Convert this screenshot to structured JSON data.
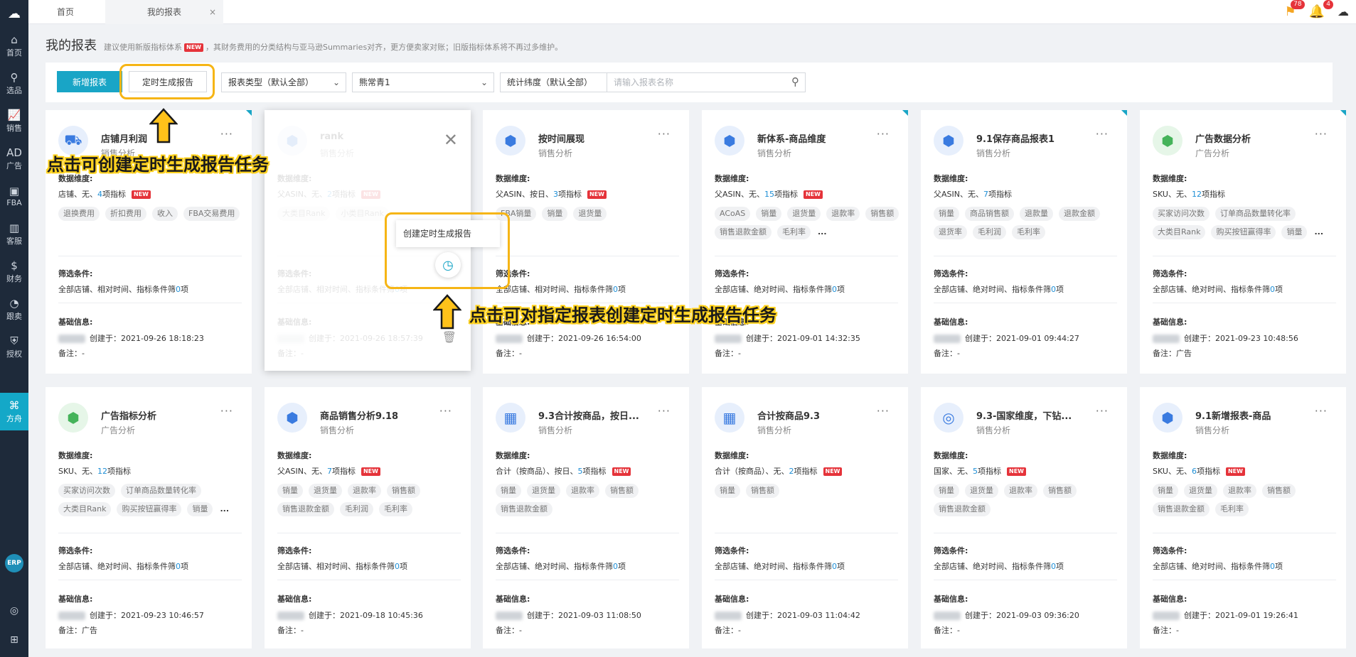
{
  "sidebar": {
    "items": [
      {
        "label": "首页",
        "icon": "home-icon",
        "glyph": "⌂"
      },
      {
        "label": "选品",
        "icon": "search-icon",
        "glyph": "⚲"
      },
      {
        "label": "销售",
        "icon": "chart-icon",
        "glyph": "📈"
      },
      {
        "label": "广告",
        "icon": "ad-icon",
        "glyph": "AD"
      },
      {
        "label": "FBA",
        "icon": "fba-icon",
        "glyph": "▣"
      },
      {
        "label": "客服",
        "icon": "service-icon",
        "glyph": "▥"
      },
      {
        "label": "财务",
        "icon": "finance-icon",
        "glyph": "$"
      },
      {
        "label": "跟卖",
        "icon": "follow-icon",
        "glyph": "◔"
      },
      {
        "label": "授权",
        "icon": "shield-icon",
        "glyph": "⛨"
      },
      {
        "label": "方舟",
        "icon": "ark-icon",
        "glyph": "⌘"
      }
    ],
    "erp": "ERP"
  },
  "tabs": [
    {
      "label": "首页"
    },
    {
      "label": "我的报表",
      "close": "×"
    }
  ],
  "notifications": {
    "flag_count": "78",
    "bell_count": "4"
  },
  "header": {
    "title": "我的报表",
    "note_before": "建议使用新版指标体系",
    "new_tag": "NEW",
    "note_after": "，其财务费用的分类结构与亚马逊Summaries对齐，更方便卖家对账；旧版指标体系将不再过多维护。"
  },
  "toolbar": {
    "new_report": "新增报表",
    "scheduled": "定时生成报告",
    "report_type": "报表类型（默认全部）",
    "store": "熊常青1",
    "stat_dim": "统计纬度（默认全部）",
    "search_placeholder": "请输入报表名称"
  },
  "labels": {
    "dims": "数据维度:",
    "filters": "筛选条件:",
    "basic": "基础信息:",
    "created": "创建于：",
    "remark": "备注："
  },
  "cards": [
    {
      "title": "店铺月利润",
      "sub": "销售分析",
      "dim": "店铺、无、",
      "num": "4",
      "unit": "项指标",
      "new": "NEW",
      "tags": [
        "退换费用",
        "折扣费用",
        "收入",
        "FBA交易费用"
      ],
      "filter_a": "全部店铺、相对时间、指标条件筛",
      "filter_n": "0",
      "filter_b": "项",
      "created": "2021-09-26 18:18:23",
      "remark": "-"
    },
    {
      "title": "rank",
      "sub": "销售分析",
      "dim": "父ASIN、无、",
      "num": "2",
      "unit": "项指标",
      "new": "NEW",
      "tags": [
        "大类目Rank",
        "小类目Rank"
      ],
      "filter_a": "全部店铺、相对时间、指标条件筛",
      "filter_n": "0",
      "filter_b": "项",
      "created": "2021-09-26 18:57:39",
      "remark": "-"
    },
    {
      "title": "按时间展现",
      "sub": "销售分析",
      "dim": "父ASIN、按日、",
      "num": "3",
      "unit": "项指标",
      "new": "NEW",
      "tags": [
        "FBA销量",
        "销量",
        "退货量"
      ],
      "filter_a": "全部店铺、相对时间、指标条件筛",
      "filter_n": "0",
      "filter_b": "项",
      "created": "2021-09-26 16:54:00",
      "remark": "-"
    },
    {
      "title": "新体系-商品维度",
      "sub": "销售分析",
      "dim": "父ASIN、无、",
      "num": "15",
      "unit": "项指标",
      "new": "NEW",
      "tags": [
        "ACoAS",
        "销量",
        "退货量",
        "退款率",
        "销售额",
        "销售退款金额",
        "毛利率",
        "..."
      ],
      "filter_a": "全部店铺、绝对时间、指标条件筛",
      "filter_n": "0",
      "filter_b": "项",
      "created": "2021-09-01 14:32:35",
      "remark": "-"
    },
    {
      "title": "9.1保存商品报表1",
      "sub": "销售分析",
      "dim": "父ASIN、无、",
      "num": "7",
      "unit": "项指标",
      "new": "",
      "tags": [
        "销量",
        "商品销售额",
        "退款量",
        "退款金额",
        "退货率",
        "毛利润",
        "毛利率"
      ],
      "filter_a": "全部店铺、绝对时间、指标条件筛",
      "filter_n": "0",
      "filter_b": "项",
      "created": "2021-09-01 09:44:27",
      "remark": "-"
    },
    {
      "title": "广告数据分析",
      "sub": "广告分析",
      "dim": "SKU、无、",
      "num": "12",
      "unit": "项指标",
      "new": "",
      "tags": [
        "买家访问次数",
        "订单商品数量转化率",
        "大类目Rank",
        "购买按钮赢得率",
        "销量",
        "..."
      ],
      "filter_a": "全部店铺、绝对时间、指标条件筛",
      "filter_n": "0",
      "filter_b": "项",
      "created": "2021-09-23 10:48:56",
      "remark": "广告"
    },
    {
      "title": "广告指标分析",
      "sub": "广告分析",
      "dim": "SKU、无、",
      "num": "12",
      "unit": "项指标",
      "new": "",
      "tags": [
        "买家访问次数",
        "订单商品数量转化率",
        "大类目Rank",
        "购买按钮赢得率",
        "销量",
        "..."
      ],
      "filter_a": "全部店铺、绝对时间、指标条件筛",
      "filter_n": "0",
      "filter_b": "项",
      "created": "2021-09-23 10:46:57",
      "remark": "广告"
    },
    {
      "title": "商品销售分析9.18",
      "sub": "销售分析",
      "dim": "父ASIN、无、",
      "num": "7",
      "unit": "项指标",
      "new": "NEW",
      "tags": [
        "销量",
        "退货量",
        "退款率",
        "销售额",
        "销售退款金额",
        "毛利润",
        "毛利率"
      ],
      "filter_a": "全部店铺、相对时间、指标条件筛",
      "filter_n": "0",
      "filter_b": "项",
      "created": "2021-09-18 10:45:36",
      "remark": "-"
    },
    {
      "title": "9.3合计按商品，按日...",
      "sub": "销售分析",
      "dim": "合计（按商品）、按日、",
      "num": "5",
      "unit": "项指标",
      "new": "NEW",
      "tags": [
        "销量",
        "退货量",
        "退款率",
        "销售额",
        "销售退款金额"
      ],
      "filter_a": "全部店铺、绝对时间、指标条件筛",
      "filter_n": "0",
      "filter_b": "项",
      "created": "2021-09-03 11:08:50",
      "remark": "-"
    },
    {
      "title": "合计按商品9.3",
      "sub": "销售分析",
      "dim": "合计（按商品）、无、",
      "num": "2",
      "unit": "项指标",
      "new": "NEW",
      "tags": [
        "销量",
        "销售额"
      ],
      "filter_a": "全部店铺、绝对时间、指标条件筛",
      "filter_n": "0",
      "filter_b": "项",
      "created": "2021-09-03 11:04:42",
      "remark": "-"
    },
    {
      "title": "9.3-国家维度，下钻...",
      "sub": "销售分析",
      "dim": "国家、无、",
      "num": "5",
      "unit": "项指标",
      "new": "NEW",
      "tags": [
        "销量",
        "退货量",
        "退款率",
        "销售额",
        "销售退款金额"
      ],
      "filter_a": "全部店铺、绝对时间、指标条件筛",
      "filter_n": "0",
      "filter_b": "项",
      "created": "2021-09-03 09:36:20",
      "remark": "-"
    },
    {
      "title": "9.1新增报表-商品",
      "sub": "销售分析",
      "dim": "SKU、无、",
      "num": "6",
      "unit": "项指标",
      "new": "NEW",
      "tags": [
        "销量",
        "退货量",
        "退款率",
        "销售额",
        "销售退款金额",
        "毛利率"
      ],
      "filter_a": "全部店铺、绝对时间、指标条件筛",
      "filter_n": "0",
      "filter_b": "项",
      "created": "2021-09-01 19:26:41",
      "remark": "-"
    }
  ],
  "popup": {
    "label": "创建定时生成报告"
  },
  "annotations": {
    "a1": "点击可创建定时生成报告任务",
    "a2": "点击可对指定报表创建定时生成报告任务"
  },
  "colors": {
    "accent": "#19a5c6",
    "highlight": "#f6b515",
    "new_badge": "#e5333a",
    "sidebar": "#1e2a3a"
  }
}
